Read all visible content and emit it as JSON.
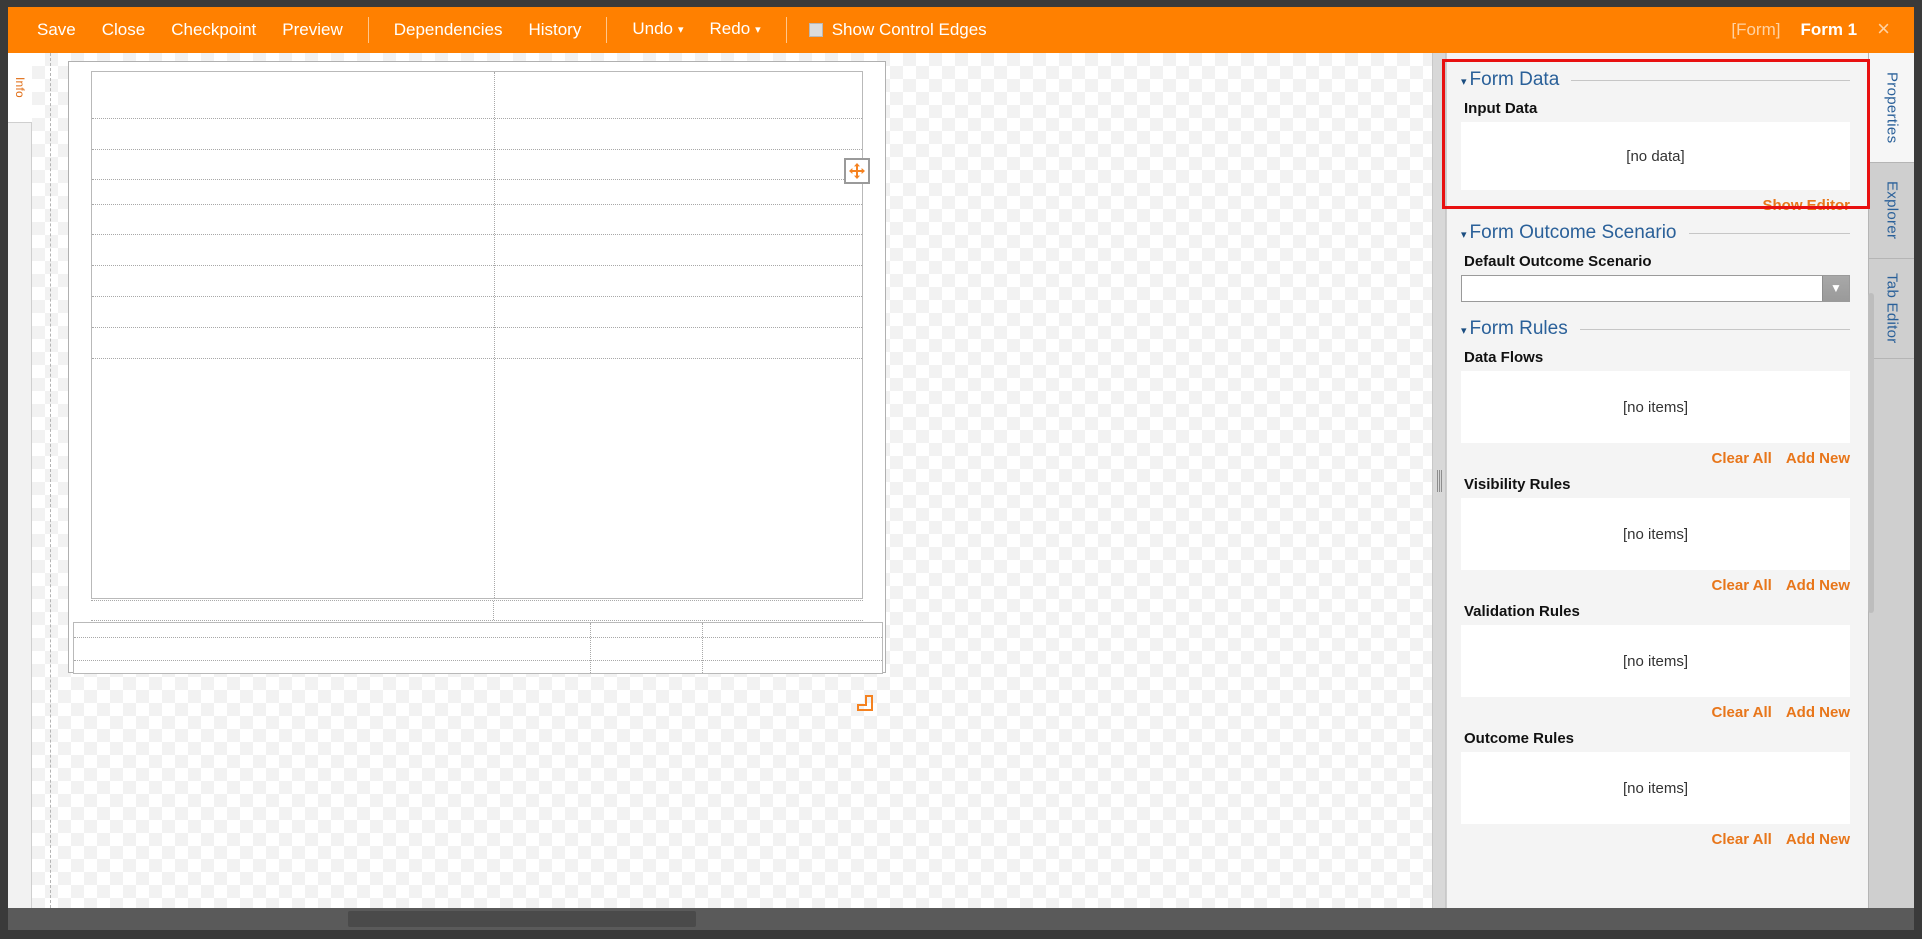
{
  "window": {
    "title": "Form Designer",
    "accent_orange": "#FF8000",
    "link_orange": "#E8761A",
    "section_blue": "#2A6099",
    "highlight_red": "#E81010"
  },
  "toolbar": {
    "save": "Save",
    "close": "Close",
    "checkpoint": "Checkpoint",
    "preview": "Preview",
    "dependencies": "Dependencies",
    "history": "History",
    "undo": "Undo",
    "redo": "Redo",
    "caret": "▾",
    "show_control_edges": "Show Control Edges",
    "show_control_edges_checked": false,
    "form_tag": "[Form]",
    "active_form": "Form 1",
    "close_x": "×"
  },
  "left_strip": {
    "tab_info": "Info"
  },
  "right_strip": {
    "tabs": [
      {
        "label": "Properties",
        "active": true
      },
      {
        "label": "Explorer",
        "active": false
      },
      {
        "label": "Tab Editor",
        "active": false
      }
    ]
  },
  "panel": {
    "form_data": {
      "title": "Form Data",
      "arrow": "▾",
      "input_data_label": "Input Data",
      "input_data_value": "[no data]",
      "show_editor_link": "Show Editor"
    },
    "form_outcome_scenario": {
      "title": "Form Outcome Scenario",
      "arrow": "▾",
      "default_label": "Default Outcome Scenario",
      "default_value": "",
      "dropdown_caret": "▼"
    },
    "form_rules": {
      "title": "Form Rules",
      "arrow": "▾",
      "groups": [
        {
          "label": "Data Flows",
          "empty_text": "[no items]",
          "clear_all": "Clear All",
          "add_new": "Add New"
        },
        {
          "label": "Visibility Rules",
          "empty_text": "[no items]",
          "clear_all": "Clear All",
          "add_new": "Add New"
        },
        {
          "label": "Validation Rules",
          "empty_text": "[no items]",
          "clear_all": "Clear All",
          "add_new": "Add New"
        },
        {
          "label": "Outcome Rules",
          "empty_text": "[no items]",
          "clear_all": "Clear All",
          "add_new": "Add New"
        }
      ]
    }
  },
  "canvas": {
    "move_handle_icon": "move-arrows-icon",
    "resize_handle_icon": "resize-corner-icon",
    "top_block_rows": 9,
    "bottom_block_rows": 2
  }
}
